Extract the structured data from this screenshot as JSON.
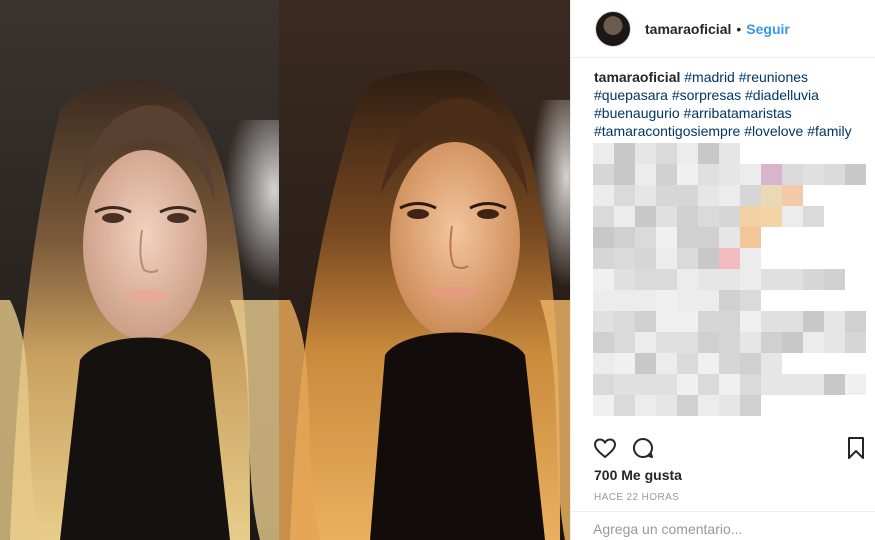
{
  "post": {
    "username": "tamaraoficial",
    "separator": "•",
    "follow_label": "Seguir",
    "caption": {
      "username": "tamaraoficial",
      "hashtags": [
        "#madrid",
        "#reuniones",
        "#quepasara",
        "#sorpresas",
        "#diadelluvia",
        "#buenaugurio",
        "#arribatamaristas",
        "#tamaracontigosiempre",
        "#lovelove",
        "#family"
      ]
    },
    "likes_label": "700 Me gusta",
    "timestamp": "HACE 22 HORAS",
    "comment_placeholder": "Agrega un comentario..."
  },
  "icons": {
    "like": "heart-icon",
    "comment": "comment-icon",
    "save": "bookmark-icon"
  },
  "colors": {
    "link_blue": "#3897f0",
    "hashtag": "#003569",
    "text": "#262626",
    "muted": "#999999",
    "border": "#efefef"
  }
}
